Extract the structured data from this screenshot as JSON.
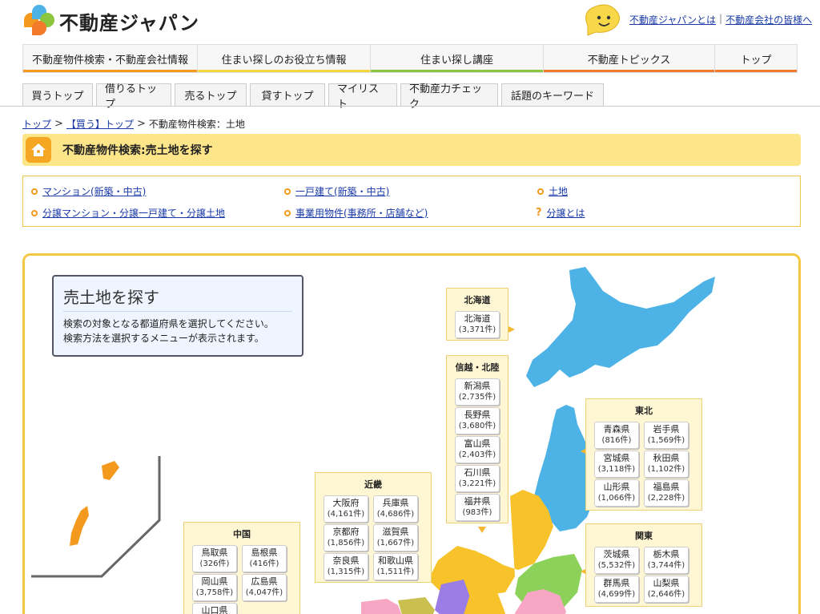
{
  "header": {
    "logo_text": "不動産ジャパン",
    "links": [
      "不動産ジャパンとは",
      "不動産会社の皆様へ"
    ],
    "separator": "|"
  },
  "main_nav": [
    {
      "label": "不動産物件検索・不動産会社情報",
      "color": "#f39a1e"
    },
    {
      "label": "住まい探しのお役立ち情報",
      "color": "#f7d53c"
    },
    {
      "label": "住まい探し講座",
      "color": "#8cc63e"
    },
    {
      "label": "不動産トピックス",
      "color": "#f27a2a"
    },
    {
      "label": "トップ",
      "color": "#f27a2a"
    }
  ],
  "sub_nav": [
    "買うトップ",
    "借りるトップ",
    "売るトップ",
    "貸すトップ",
    "マイリスト",
    "不動産力チェック",
    "話題のキーワード"
  ],
  "breadcrumb": {
    "items": [
      "トップ",
      "【買う】トップ",
      "不動産物件検索：土地"
    ],
    "separator": ">"
  },
  "title": "不動産物件検索:売土地を探す",
  "categories": [
    "マンション(新築・中古)",
    "一戸建て(新築・中古)",
    "土地",
    "分譲マンション・分譲一戸建て・分譲土地",
    "事業用物件(事務所・店舗など)",
    "分譲とは"
  ],
  "category_qmark": "?",
  "intro": {
    "title": "売土地を探す",
    "text1": "検索の対象となる都道府県を選択してください。",
    "text2": "検索方法を選択するメニューが表示されます。"
  },
  "regions": {
    "hokkaido": {
      "title": "北海道",
      "prefs": [
        {
          "name": "北海道",
          "count": "(3,371件)"
        }
      ]
    },
    "shinetsu": {
      "title": "信越・北陸",
      "prefs": [
        {
          "name": "新潟県",
          "count": "(2,735件)"
        },
        {
          "name": "長野県",
          "count": "(3,680件)"
        },
        {
          "name": "富山県",
          "count": "(2,403件)"
        },
        {
          "name": "石川県",
          "count": "(3,221件)"
        },
        {
          "name": "福井県",
          "count": "(983件)"
        }
      ]
    },
    "tohoku": {
      "title": "東北",
      "prefs": [
        {
          "name": "青森県",
          "count": "(816件)"
        },
        {
          "name": "岩手県",
          "count": "(1,569件)"
        },
        {
          "name": "宮城県",
          "count": "(3,118件)"
        },
        {
          "name": "秋田県",
          "count": "(1,102件)"
        },
        {
          "name": "山形県",
          "count": "(1,066件)"
        },
        {
          "name": "福島県",
          "count": "(2,228件)"
        }
      ]
    },
    "kinki": {
      "title": "近畿",
      "prefs": [
        {
          "name": "大阪府",
          "count": "(4,161件)"
        },
        {
          "name": "兵庫県",
          "count": "(4,686件)"
        },
        {
          "name": "京都府",
          "count": "(1,856件)"
        },
        {
          "name": "滋賀県",
          "count": "(1,667件)"
        },
        {
          "name": "奈良県",
          "count": "(1,315件)"
        },
        {
          "name": "和歌山県",
          "count": "(1,511件)"
        }
      ]
    },
    "chugoku": {
      "title": "中国",
      "prefs": [
        {
          "name": "鳥取県",
          "count": "(326件)"
        },
        {
          "name": "島根県",
          "count": "(416件)"
        },
        {
          "name": "岡山県",
          "count": "(3,758件)"
        },
        {
          "name": "広島県",
          "count": "(4,047件)"
        },
        {
          "name": "山口県",
          "count": ""
        }
      ]
    },
    "kanto": {
      "title": "関東",
      "prefs": [
        {
          "name": "茨城県",
          "count": "(5,532件)"
        },
        {
          "name": "栃木県",
          "count": "(3,744件)"
        },
        {
          "name": "群馬県",
          "count": "(4,699件)"
        },
        {
          "name": "山梨県",
          "count": "(2,646件)"
        }
      ]
    }
  },
  "colors": {
    "hokkaido": "#4db2e6",
    "honshu_north": "#4db2e6",
    "chubu": "#f7c22a",
    "kanto": "#8cd25a",
    "okinawa": "#f39a1e"
  }
}
